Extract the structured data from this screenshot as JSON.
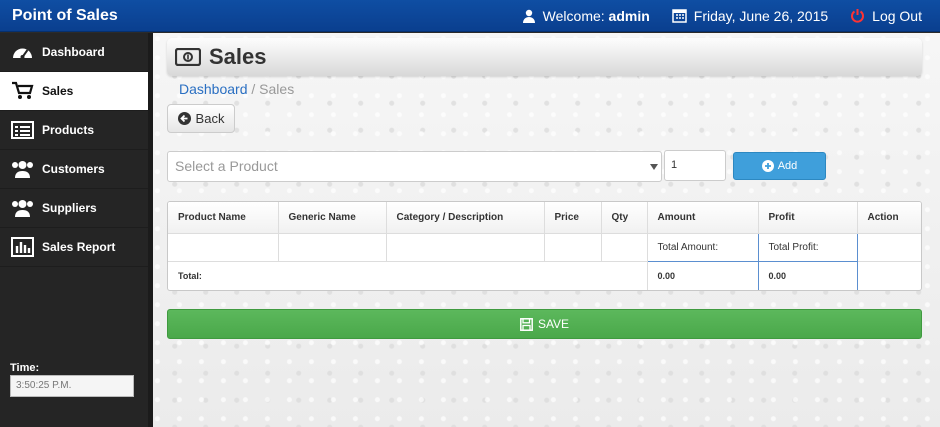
{
  "app": {
    "title": "Point of Sales"
  },
  "header": {
    "welcome_label": "Welcome:",
    "username": "admin",
    "date": "Friday, June 26, 2015",
    "logout_label": "Log Out"
  },
  "sidebar": {
    "items": [
      {
        "label": "Dashboard",
        "icon": "dashboard-icon"
      },
      {
        "label": "Sales",
        "icon": "cart-icon",
        "active": true
      },
      {
        "label": "Products",
        "icon": "list-icon"
      },
      {
        "label": "Customers",
        "icon": "users-icon"
      },
      {
        "label": "Suppliers",
        "icon": "users-icon"
      },
      {
        "label": "Sales Report",
        "icon": "bar-chart-icon"
      }
    ],
    "time_label": "Time:",
    "time_value": "3:50:25 P.M."
  },
  "page": {
    "title": "Sales",
    "breadcrumb_home": "Dashboard",
    "breadcrumb_sep": " / ",
    "breadcrumb_current": "Sales",
    "back_label": "Back",
    "product_placeholder": "Select a Product",
    "quantity": "1",
    "add_label": "Add",
    "save_label": "SAVE"
  },
  "table": {
    "columns": [
      "Product Name",
      "Generic Name",
      "Category / Description",
      "Price",
      "Qty",
      "Amount",
      "Profit",
      "Action"
    ],
    "total_amount_label": "Total Amount:",
    "total_profit_label": "Total Profit:",
    "total_label": "Total:",
    "amount_total": "0.00",
    "profit_total": "0.00"
  },
  "colors": {
    "accent": "#0f4ea3",
    "add_button": "#3f9fdb",
    "save_button": "#5cb85c"
  }
}
